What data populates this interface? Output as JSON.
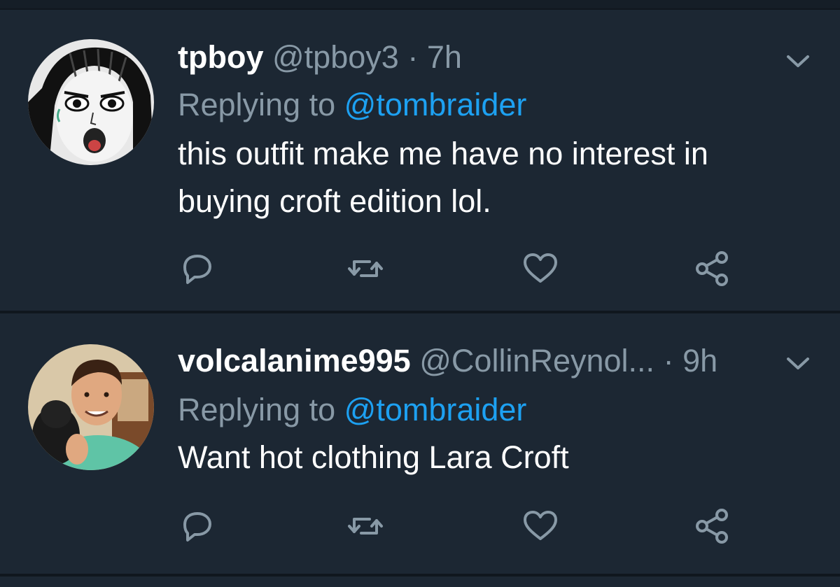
{
  "colors": {
    "background": "#1c2733",
    "separator": "#10171e",
    "text_primary": "#ffffff",
    "text_secondary": "#8899a6",
    "accent": "#1da1f2"
  },
  "tweets": [
    {
      "display_name": "tpboy",
      "handle": "@tpboy3",
      "dot": "·",
      "time": "7h",
      "replying_prefix": "Replying to ",
      "replying_to": "@tombraider",
      "text": "this outfit make me have no interest in buying croft edition lol.",
      "avatar_icon": "manga-face-avatar",
      "menu_icon": "chevron-down-icon",
      "actions": [
        "reply-icon",
        "retweet-icon",
        "like-icon",
        "share-icon"
      ]
    },
    {
      "display_name": "volcalanime995",
      "handle": "@CollinReynol...",
      "dot": "·",
      "time": "9h",
      "replying_prefix": "Replying to ",
      "replying_to": "@tombraider",
      "text": "Want hot clothing Lara Croft",
      "avatar_icon": "photo-avatar",
      "menu_icon": "chevron-down-icon",
      "actions": [
        "reply-icon",
        "retweet-icon",
        "like-icon",
        "share-icon"
      ]
    }
  ]
}
